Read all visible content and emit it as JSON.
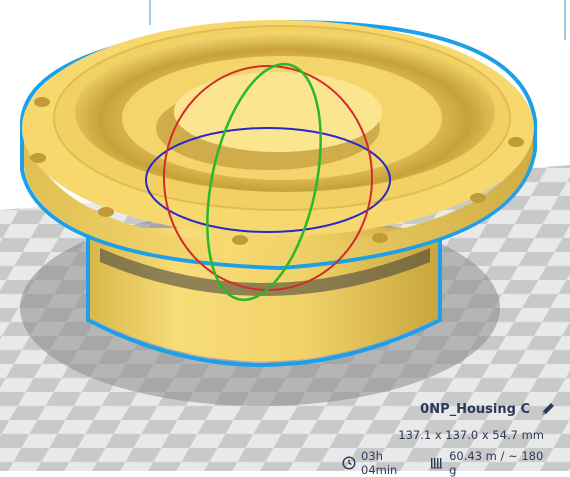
{
  "object": {
    "name": "0NP_Housing C",
    "dimensions": "137.1 x 137.0 x 54.7 mm",
    "print_time": "03h 04min",
    "material": "60.43 m / ~ 180 g"
  },
  "icons": {
    "edit": "pencil-icon",
    "time": "clock-icon",
    "material": "filament-spool-icon"
  },
  "colors": {
    "model": "#f5d66e",
    "model_outline": "#1ea0e8",
    "rotate_x": "#d42a2a",
    "rotate_y": "#2ab82a",
    "rotate_z": "#2a2ac8",
    "build_plate_light": "#ffffff",
    "build_plate_dark": "#c4c4c4"
  }
}
